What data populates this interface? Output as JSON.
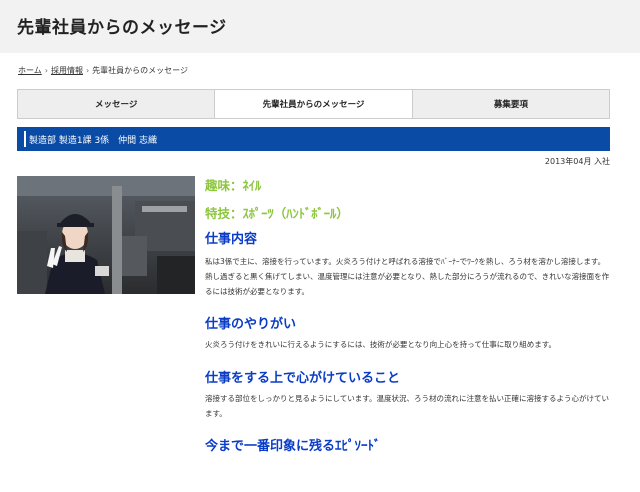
{
  "header": {
    "title": "先輩社員からのメッセージ"
  },
  "breadcrumb": {
    "home": "ホーム",
    "recruit": "採用情報",
    "current": "先輩社員からのメッセージ"
  },
  "tabs": [
    {
      "label": "メッセージ",
      "active": false
    },
    {
      "label": "先輩社員からのメッセージ",
      "active": true
    },
    {
      "label": "募集要項",
      "active": false
    }
  ],
  "profile": {
    "department": "製造部 製造1課 3係　仲間 志織",
    "join_date": "2013年04月 入社",
    "hobby": "趣味：ﾈｲﾙ",
    "skill": "特技：ｽﾎﾟｰﾂ（ﾊﾝﾄﾞﾎﾞｰﾙ）"
  },
  "sections": [
    {
      "heading": "仕事内容",
      "body": "私は3係で主に、溶接を行っています。火炎ろう付けと呼ばれる溶接でﾊﾞｰﾅｰでﾜｰｸを熱し、ろう材を溶かし溶接します。熱し過ぎると黒く焦げてしまい、温度管理には注意が必要となり、熱した部分にろうが流れるので、きれいな溶接面を作るには技術が必要となります。"
    },
    {
      "heading": "仕事のやりがい",
      "body": "火炎ろう付けをきれいに行えるようにするには、技術が必要となり向上心を持って仕事に取り組めます。"
    },
    {
      "heading": "仕事をする上で心がけていること",
      "body": "溶接する部位をしっかりと見るようにしています。温度状況、ろう材の流れに注意を払い正確に溶接するよう心がけています。"
    },
    {
      "heading": "今まで一番印象に残るｴﾋﾟｿｰﾄﾞ",
      "body": ""
    }
  ],
  "colors": {
    "accent_blue": "#0a4ba6",
    "heading_blue": "#0a3cc8",
    "hobby_green": "#8dc63f"
  }
}
